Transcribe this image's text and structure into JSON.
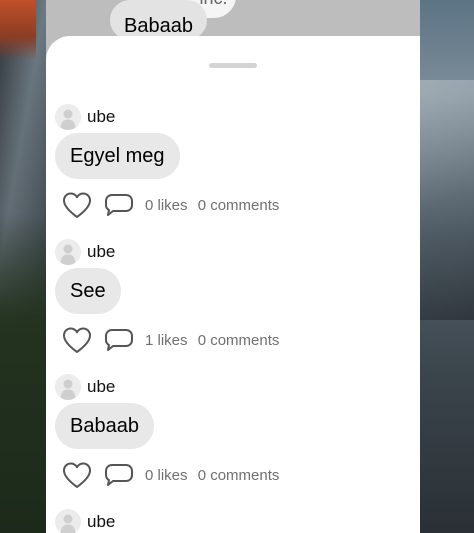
{
  "background_app": {
    "partial_bubble_text": "Apple inc.",
    "bubble_text": "Babaab"
  },
  "posts": [
    {
      "author": "ube",
      "message": "Egyel meg",
      "likes": "0 likes",
      "comments": "0 comments"
    },
    {
      "author": "ube",
      "message": "See",
      "likes": "1 likes",
      "comments": "0 comments"
    },
    {
      "author": "ube",
      "message": "Babaab",
      "likes": "0 likes",
      "comments": "0 comments"
    },
    {
      "author": "ube"
    }
  ],
  "icons": {
    "like": "heart-icon",
    "comment": "comment-bubble-icon",
    "avatar": "person-silhouette-icon"
  },
  "colors": {
    "sheet_background": "#ffffff",
    "bubble_background": "#e8e8e8",
    "secondary_text": "#707070"
  }
}
